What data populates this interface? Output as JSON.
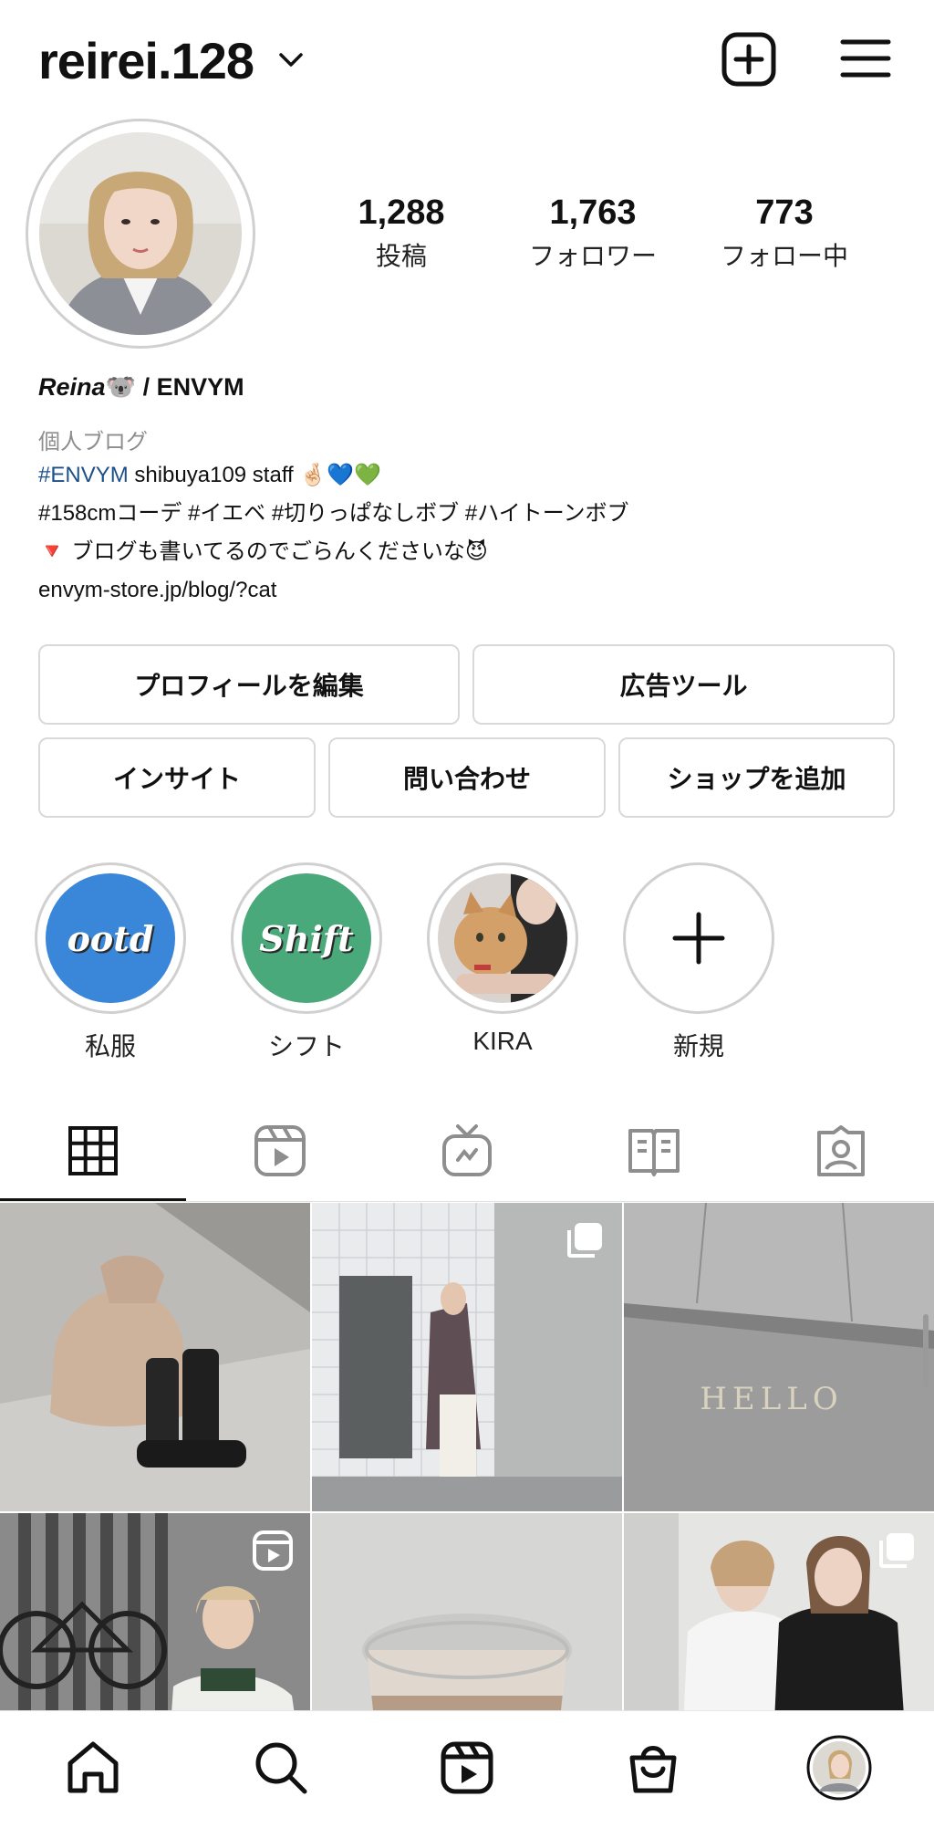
{
  "header": {
    "username": "reirei.128",
    "icons": {
      "switch_account": "chevron-down-icon",
      "create": "plus-square-icon",
      "menu": "hamburger-menu-icon"
    }
  },
  "stats": [
    {
      "value": "1,288",
      "label": "投稿"
    },
    {
      "value": "1,763",
      "label": "フォロワー"
    },
    {
      "value": "773",
      "label": "フォロー中"
    }
  ],
  "bio": {
    "display_name_italic": "Reina",
    "display_name_emoji": "🐨",
    "display_name_rest": " / ENVYM",
    "category": "個人ブログ",
    "line1_tag": "#ENVYM",
    "line1_text": " shibuya109 staff 🤞🏻💙💚",
    "line2_tags": "#158cmコーデ #イエベ #切りっぱなしボブ #ハイトーンボブ",
    "line3": "🔻 ブログも書いてるのでごらんくださいな😈",
    "link": "envym-store.jp/blog/?cat"
  },
  "buttons": {
    "edit_profile": "プロフィールを編集",
    "ad_tools": "広告ツール",
    "insights": "インサイト",
    "contact": "問い合わせ",
    "add_shop": "ショップを追加"
  },
  "highlights": [
    {
      "label": "私服",
      "cover_text": "ootd",
      "color": "#3a86d9"
    },
    {
      "label": "シフト",
      "cover_text": "Shift",
      "color": "#4aa97a"
    },
    {
      "label": "KIRA",
      "cover_text": "",
      "color": "#c9a27a"
    },
    {
      "label": "新規",
      "cover_text": "",
      "color": "#ffffff"
    }
  ],
  "tabs": [
    "grid-icon",
    "reels-icon",
    "igtv-icon",
    "guides-icon",
    "tagged-icon"
  ],
  "grid_overlay_text": "HELLO",
  "bottom_nav": [
    "home-icon",
    "search-icon",
    "reels-icon",
    "shop-icon",
    "profile-avatar"
  ],
  "colors": {
    "link_blue": "#1d4f8a",
    "border": "#d9d9d9",
    "text": "#111111",
    "muted": "#8e8e8e"
  }
}
